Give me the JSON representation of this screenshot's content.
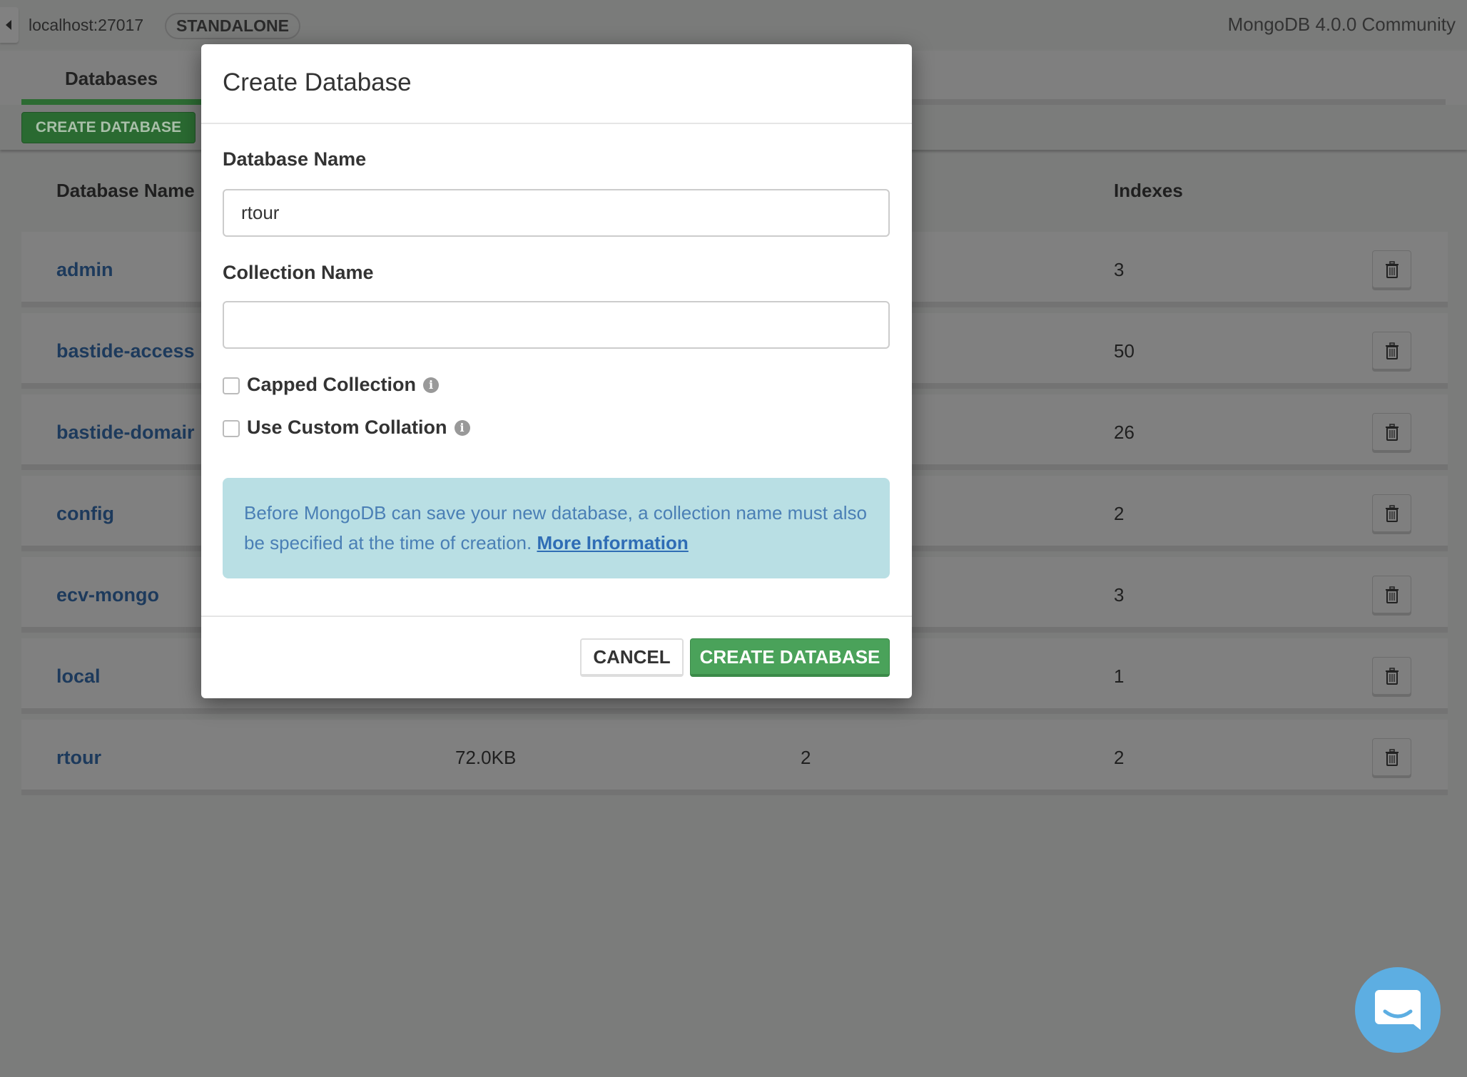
{
  "topbar": {
    "host": "localhost:27017",
    "topology": "STANDALONE",
    "version": "MongoDB 4.0.0 Community"
  },
  "tabs": [
    {
      "label": "Databases",
      "active": true
    }
  ],
  "toolbar": {
    "create_label": "CREATE DATABASE"
  },
  "table": {
    "headers": {
      "name": "Database Name",
      "indexes": "Indexes"
    },
    "rows": [
      {
        "name": "admin",
        "storage": "",
        "collections": "",
        "indexes": "3"
      },
      {
        "name": "bastide-access",
        "storage": "",
        "collections": "",
        "indexes": "50"
      },
      {
        "name": "bastide-domair",
        "storage": "",
        "collections": "",
        "indexes": "26"
      },
      {
        "name": "config",
        "storage": "",
        "collections": "",
        "indexes": "2"
      },
      {
        "name": "ecv-mongo",
        "storage": "",
        "collections": "",
        "indexes": "3"
      },
      {
        "name": "local",
        "storage": "",
        "collections": "",
        "indexes": "1"
      },
      {
        "name": "rtour",
        "storage": "72.0KB",
        "collections": "2",
        "indexes": "2"
      }
    ]
  },
  "modal": {
    "title": "Create Database",
    "db_label": "Database Name",
    "db_value": "rtour",
    "coll_label": "Collection Name",
    "coll_value": "",
    "capped_label": "Capped Collection",
    "capped_checked": false,
    "collation_label": "Use Custom Collation",
    "collation_checked": false,
    "note_text": "Before MongoDB can save your new database, a collection name must also be specified at the time of creation.",
    "note_link": "More Information",
    "cancel_label": "CANCEL",
    "create_label": "CREATE DATABASE"
  },
  "colors": {
    "accent_green": "#4aa25a",
    "info_bg": "#b9dfe4",
    "chat": "#5daee2"
  },
  "icons": {
    "trash": "trash-icon",
    "info": "info-icon",
    "chat": "chat-bubble-icon",
    "back": "caret-left-icon"
  }
}
